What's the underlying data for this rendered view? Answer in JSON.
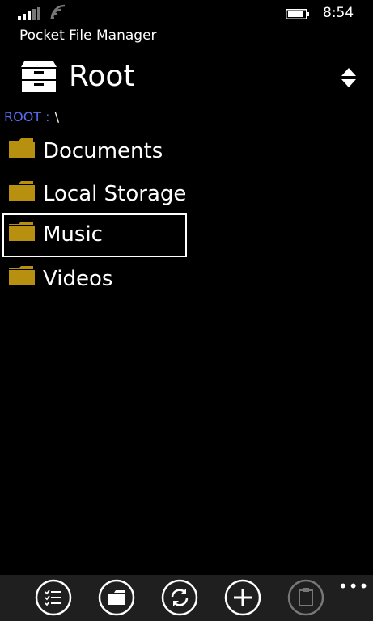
{
  "status_bar": {
    "time": "8:54",
    "signal_icon": "signal-bars-icon",
    "wifi_icon": "wifi-icon",
    "battery_icon": "battery-icon"
  },
  "app": {
    "title": "Pocket File Manager"
  },
  "header": {
    "title": "Root",
    "icon": "file-cabinet-icon",
    "sort_icon": "sort-up-down-icon"
  },
  "breadcrumb": {
    "label": "ROOT :",
    "path": "\\"
  },
  "folders": [
    {
      "name": "Documents",
      "icon": "folder-icon",
      "selected": false
    },
    {
      "name": "Local Storage",
      "icon": "folder-icon",
      "selected": false
    },
    {
      "name": "Music",
      "icon": "folder-icon",
      "selected": true
    },
    {
      "name": "Videos",
      "icon": "folder-icon",
      "selected": false
    }
  ],
  "app_bar": {
    "buttons": [
      {
        "name": "select-list-button",
        "icon": "checklist-icon",
        "enabled": true
      },
      {
        "name": "folder-button",
        "icon": "folder-icon",
        "enabled": true
      },
      {
        "name": "refresh-button",
        "icon": "refresh-icon",
        "enabled": true
      },
      {
        "name": "add-button",
        "icon": "plus-icon",
        "enabled": true
      },
      {
        "name": "paste-button",
        "icon": "clipboard-icon",
        "enabled": false
      }
    ],
    "more_label": "•••"
  },
  "colors": {
    "background": "#000000",
    "accent_breadcrumb": "#5b6cf3",
    "folder": "#b8900f",
    "app_bar": "#1f1f1f",
    "text": "#ffffff"
  }
}
